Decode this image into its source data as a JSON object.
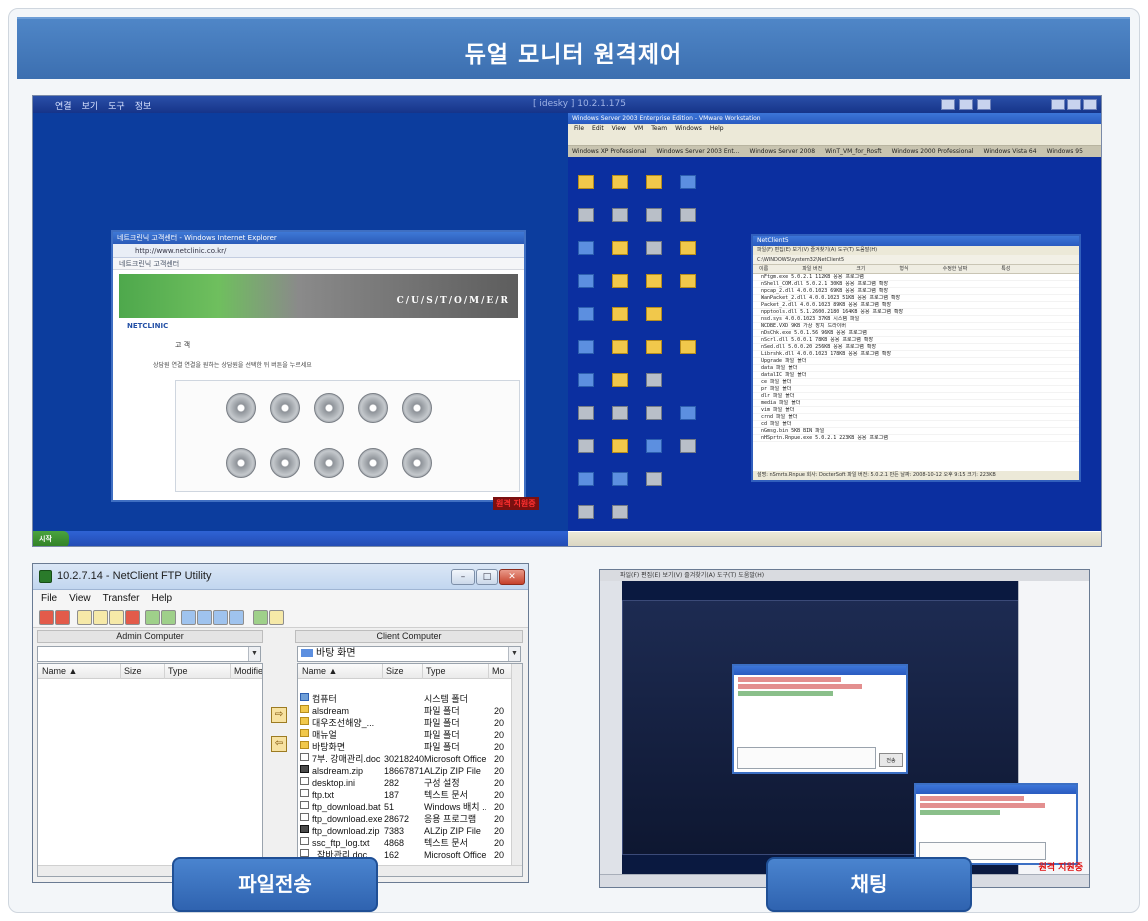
{
  "banner": {
    "title": "듀얼 모니터 원격제어"
  },
  "remote_desktop": {
    "menu": [
      "연결",
      "보기",
      "도구",
      "정보"
    ],
    "title": "[ idesky ] 10.2.1.175",
    "ie_window": {
      "title": "네트크린닉 고객센터 - Windows Internet Explorer",
      "address": "http://www.netclinic.co.kr/",
      "tab_label": "네트크린닉 고객센터",
      "banner_text": "C/U/S/T/O/M/E/R",
      "brand": "NETCLINIC",
      "section_label": "고 객",
      "instruction": "상담원 연결   연결을 원하는 상담원을 선택한 뒤 버튼을 누르세요",
      "button_count": 10
    },
    "remote_label": "원격 지원중",
    "vm_window": {
      "title": "Windows Server 2003 Enterprise Edition - VMware Workstation",
      "menu": [
        "File",
        "Edit",
        "View",
        "VM",
        "Team",
        "Windows",
        "Help"
      ],
      "tabs": [
        "Windows XP Professional",
        "Windows Server 2003 Ent...",
        "Windows Server 2008",
        "WinT_VM_for_Rosft",
        "Windows 2000 Professional",
        "Windows Vista 64",
        "Windows 95"
      ],
      "explorer": {
        "title": "NetClient5",
        "address": "C:\\WINDOWS\\system32\\NetClient5",
        "columns": [
          "이름",
          "파일 버전",
          "크기",
          "형식",
          "수정한 날짜",
          "특성"
        ],
        "rows": [
          "nFtgm.exe    5.0.2.1   112KB  응용 프로그램",
          "nShell_COM.dll  5.0.2.1  30KB  응용 프로그램 확장",
          "npcap_2.dll  4.0.0.1023  69KB  응용 프로그램 확장",
          "WanPacket_2.dll  4.0.0.1023  51KB  응용 프로그램 확장",
          "Packet_2.dll  4.0.0.1023  89KB  응용 프로그램 확장",
          "npptools.dll  5.1.2600.2180  164KB  응용 프로그램 확장",
          "nsd.sys   4.0.0.1023  37KB  시스템 파일",
          "NCDBE.VXD   9KB  가상 장치 드라이버",
          "nDsChk.exe  5.0.1.56  96KB  응용 프로그램",
          "nScrl.dll   5.0.0.1  78KB  응용 프로그램 확장",
          "nSed.dll   5.0.0.20  256KB  응용 프로그램 확장",
          "Librshk.dll  4.0.0.1023  178KB  응용 프로그램 확장",
          "Upgrade   파일 폴더",
          "data   파일 폴더",
          "datalIC   파일 폴더",
          "ce   파일 폴더",
          "pr   파일 폴더",
          "dlr   파일 폴더",
          "media   파일 폴더",
          "vim   파일 폴더",
          "crnd   파일 폴더",
          "cd   파일 폴더",
          "nGmsg.bin   5KB  BIN 파일",
          "nHSprtn.Rnpue.exe  5.0.2.1  223KB  응용 프로그램"
        ],
        "status": "설명: nSmrts.Rnpue 회사: DocterSoft 파일 버전: 5.0.2.1 만든 날짜: 2008-10-12 오후 9:15 크기: 223KB",
        "status_right": "내 컴퓨터"
      },
      "taskbar": [
        "NetClient5",
        "Windows 작업 관리자"
      ],
      "clock": "오후 7:15"
    }
  },
  "ftp": {
    "title": "10.2.7.14 - NetClient FTP Utility",
    "menu": [
      "File",
      "View",
      "Transfer",
      "Help"
    ],
    "admin_header": "Admin Computer",
    "client_header": "Client Computer",
    "admin_path": "",
    "client_path": "바탕 화면",
    "admin_columns": [
      "Name",
      "Size",
      "Type",
      "Modifie"
    ],
    "client_columns": [
      "Name",
      "Size",
      "Type",
      "Mo"
    ],
    "client_files": [
      {
        "icon": "pc",
        "name": "컴퓨터",
        "size": "",
        "type": "시스템 폴더",
        "mod": ""
      },
      {
        "icon": "folder",
        "name": "alsdream",
        "size": "",
        "type": "파일 폴더",
        "mod": "20"
      },
      {
        "icon": "folder",
        "name": "대우조선해양_...",
        "size": "",
        "type": "파일 폴더",
        "mod": "20"
      },
      {
        "icon": "folder",
        "name": "매뉴얼",
        "size": "",
        "type": "파일 폴더",
        "mod": "20"
      },
      {
        "icon": "folder",
        "name": "바탕화면",
        "size": "",
        "type": "파일 폴더",
        "mod": "20"
      },
      {
        "icon": "doc",
        "name": "7부. 강매관리.doc",
        "size": "30218240",
        "type": "Microsoft Office...",
        "mod": "20"
      },
      {
        "icon": "zip",
        "name": "alsdream.zip",
        "size": "18667871",
        "type": "ALZip ZIP File",
        "mod": "20"
      },
      {
        "icon": "doc",
        "name": "desktop.ini",
        "size": "282",
        "type": "구성 설정",
        "mod": "20"
      },
      {
        "icon": "doc",
        "name": "ftp.txt",
        "size": "187",
        "type": "텍스트 문서",
        "mod": "20"
      },
      {
        "icon": "doc",
        "name": "ftp_download.bat",
        "size": "51",
        "type": "Windows 배치 ...",
        "mod": "20"
      },
      {
        "icon": "doc",
        "name": "ftp_download.exe",
        "size": "28672",
        "type": "응용 프로그램",
        "mod": "20"
      },
      {
        "icon": "zip",
        "name": "ftp_download.zip",
        "size": "7383",
        "type": "ALZip ZIP File",
        "mod": "20"
      },
      {
        "icon": "doc",
        "name": "ssc_ftp_log.txt",
        "size": "4868",
        "type": "텍스트 문서",
        "mod": "20"
      },
      {
        "icon": "doc",
        "name": "_잡바관리.doc",
        "size": "162",
        "type": "Microsoft Office...",
        "mod": "20"
      }
    ],
    "upload_arrow": "⇨",
    "download_arrow": "⇦"
  },
  "chat": {
    "menu": "파일(F) 편집(E) 보기(V) 즐겨찾기(A) 도구(T) 도움말(H)",
    "send_button": "전송",
    "remote_label": "원격 지원중"
  },
  "captions": {
    "file_transfer": "파일전송",
    "chat": "채팅"
  },
  "colors": {
    "banner": "#3c6fb0",
    "caption": "#2f63b0",
    "remote_label": "#e01010"
  }
}
